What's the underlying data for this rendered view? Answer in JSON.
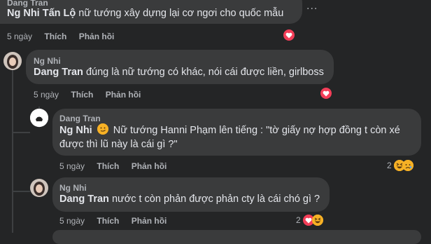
{
  "comments": [
    {
      "author": "Dang Tran",
      "mention": "Ng Nhi Tấn Lộ",
      "text_after_mention": "nữ tướng xây dựng lại cơ ngơi cho quốc mẫu",
      "time": "5 ngày",
      "like": "Thích",
      "reply": "Phản hồi"
    },
    {
      "author": "Ng Nhi",
      "mention": "Dang Tran",
      "text_after_mention": "đúng là nữ tướng có khác, nói cái được liền, girlboss",
      "time": "5 ngày",
      "like": "Thích",
      "reply": "Phản hồi"
    },
    {
      "author": "Dang Tran",
      "mention": "Ng Nhi",
      "line1_after_mention": "Nữ tướng Hanni Phạm lên tiếng : \"tờ giấy nợ hợp đồng t còn xé",
      "line2": "được thì lũ này là cái gì ?\"",
      "time": "5 ngày",
      "like": "Thích",
      "reply": "Phản hồi",
      "reaction_count": "2"
    },
    {
      "author": "Ng Nhi",
      "mention": "Dang Tran",
      "text_after_mention": "nước t còn phản được phản cty là cái chó gì ?",
      "time": "5 ngày",
      "like": "Thích",
      "reply": "Phản hồi",
      "reaction_count": "2"
    }
  ],
  "more_label": "...",
  "colors": {
    "background": "#242526",
    "bubble": "#3a3b3c",
    "heart": "#f33e58",
    "haha": "#f7b125"
  }
}
